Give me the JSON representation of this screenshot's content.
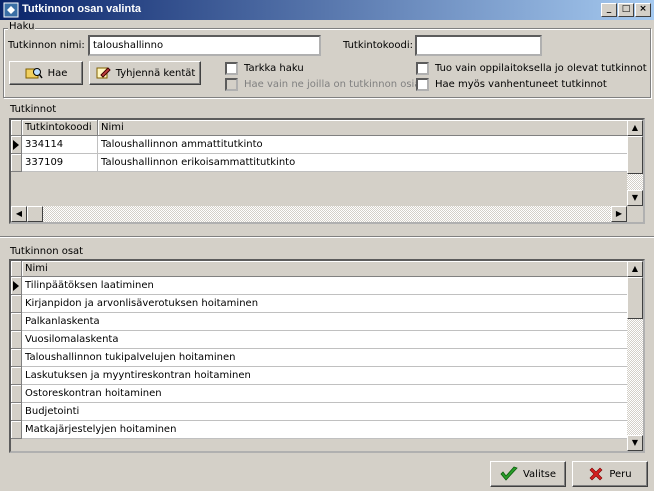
{
  "window": {
    "title": "Tutkinnon osan valinta"
  },
  "haku": {
    "group_label": "Haku",
    "name_label": "Tutkinnon nimi:",
    "name_value": "taloushallinno",
    "code_label": "Tutkintokoodi:",
    "code_value": "",
    "search_button": "Hae",
    "clear_button": "Tyhjennä kentät",
    "exact_search": "Tarkka haku",
    "only_with_parts": "Hae vain ne joilla on tutkinnon osia",
    "only_institution": "Tuo vain oppilaitoksella jo olevat tutkinnot",
    "include_obsolete": "Hae myös vanhentuneet tutkinnot"
  },
  "tutkinnot": {
    "label": "Tutkinnot",
    "columns": [
      "Tutkintokoodi",
      "Nimi"
    ],
    "rows": [
      {
        "code": "334114",
        "name": "Taloushallinnon ammattitutkinto",
        "selected": true
      },
      {
        "code": "337109",
        "name": "Taloushallinnon erikoisammattitutkinto",
        "selected": false
      }
    ]
  },
  "osat": {
    "label": "Tutkinnon osat",
    "columns": [
      "Nimi"
    ],
    "rows": [
      {
        "name": "Tilinpäätöksen laatiminen",
        "selected": true
      },
      {
        "name": "Kirjanpidon ja arvonlisäverotuksen hoitaminen",
        "selected": false
      },
      {
        "name": "Palkanlaskenta",
        "selected": false
      },
      {
        "name": "Vuosilomalaskenta",
        "selected": false
      },
      {
        "name": "Taloushallinnon tukipalvelujen hoitaminen",
        "selected": false
      },
      {
        "name": "Laskutuksen ja myyntireskontran hoitaminen",
        "selected": false
      },
      {
        "name": "Ostoreskontran hoitaminen",
        "selected": false
      },
      {
        "name": "Budjetointi",
        "selected": false
      },
      {
        "name": "Matkajärjestelyjen hoitaminen",
        "selected": false
      }
    ]
  },
  "footer": {
    "select_button": "Valitse",
    "cancel_button": "Peru"
  }
}
